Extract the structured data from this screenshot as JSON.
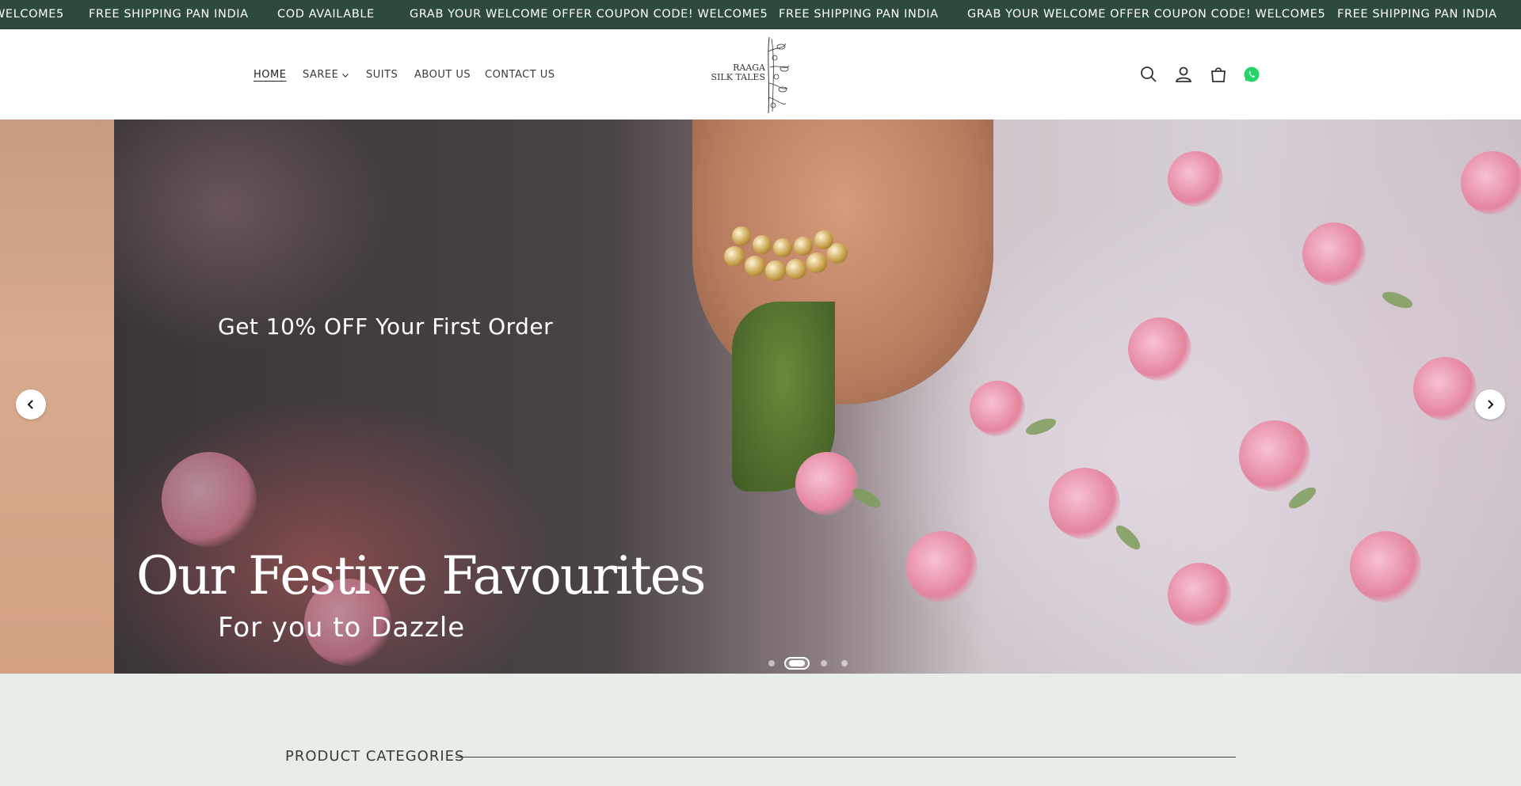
{
  "announcement": {
    "messages": [
      "WELCOME5",
      "FREE SHIPPING PAN INDIA",
      "COD AVAILABLE",
      "GRAB YOUR WELCOME OFFER COUPON CODE! WELCOME5",
      "FREE SHIPPING PAN INDIA",
      "GRAB YOUR WELCOME OFFER COUPON CODE! WELCOME5",
      "FREE SHIPPING PAN INDIA"
    ]
  },
  "nav": {
    "home": "HOME",
    "saree": "SAREE",
    "suits": "SUITS",
    "about": "ABOUT US",
    "contact": "CONTACT US"
  },
  "logo": {
    "line1": "RAAGA",
    "line2": "SILK TALES"
  },
  "header_icons": [
    "search-icon",
    "account-icon",
    "cart-icon",
    "whatsapp-icon"
  ],
  "hero": {
    "offer": "Get 10% OFF Your First Order",
    "title": "Our Festive Favourites",
    "subtitle": "For you to Dazzle",
    "slide_count": 4,
    "active_slide": 2
  },
  "categories": {
    "title": "PRODUCT CATEGORIES"
  },
  "colors": {
    "announcement_bg": "#2e4a3c",
    "categories_bg": "#e7eee7",
    "whatsapp": "#25d366"
  }
}
